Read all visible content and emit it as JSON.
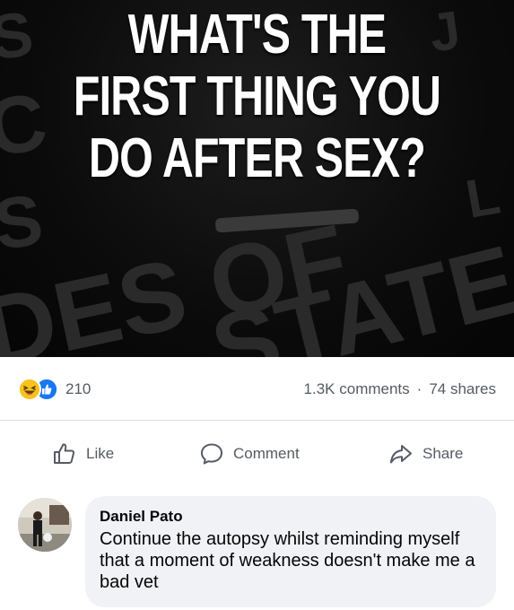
{
  "post": {
    "image": {
      "headline_lines": [
        "WHAT'S THE",
        "FIRST THING YOU",
        "DO AFTER SEX?"
      ]
    },
    "stats": {
      "reaction_icons": [
        "haha-icon",
        "like-icon"
      ],
      "reaction_count": "210",
      "comments": "1.3K comments",
      "separator": "·",
      "shares": "74 shares"
    },
    "actions": {
      "like_label": "Like",
      "comment_label": "Comment",
      "share_label": "Share"
    }
  },
  "comment": {
    "author": "Daniel Pato",
    "text": "Continue the autopsy whilst reminding myself that a moment of weakness doesn't make me a bad vet"
  },
  "colors": {
    "like_blue": "#1877f2",
    "haha_yellow": "#f7c21d",
    "secondary_text": "#555b63",
    "bubble_bg": "#f0f2f5"
  }
}
